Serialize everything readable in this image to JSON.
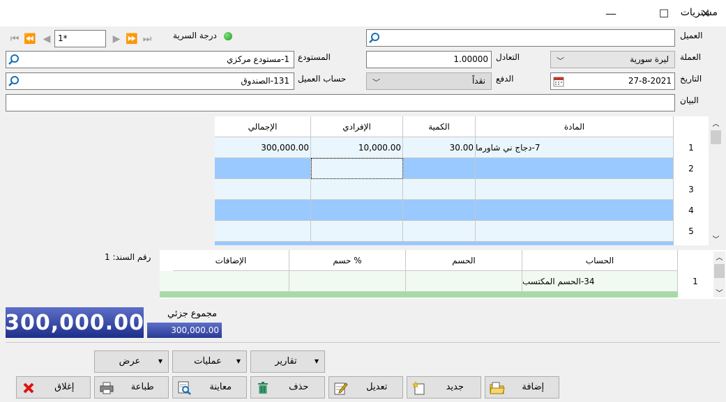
{
  "window": {
    "title": "مشتريات",
    "minimize": "—",
    "maximize": "☐",
    "close": "✕"
  },
  "nav": {
    "first": "⏮",
    "prev_fast": "⏪",
    "prev": "◀",
    "record": "1*",
    "next": "▶",
    "next_fast": "⏩",
    "last": "⏭"
  },
  "secrecy_label": "درجة السرية",
  "labels": {
    "customer": "العميل",
    "currency": "العملة",
    "date": "التاريخ",
    "description": "البيان",
    "exchange": "التعادل",
    "payment": "الدفع",
    "warehouse": "المستودع",
    "customer_account": "حساب العميل"
  },
  "values": {
    "customer": "",
    "currency": "ليرة سورية",
    "date": "27-8-2021",
    "description": "",
    "exchange": "1.00000",
    "payment": "نقداً",
    "warehouse": "1-مستودع مركزي",
    "customer_account": "131-الصندوق"
  },
  "items_table": {
    "columns": [
      "المادة",
      "الكمية",
      "الإفرادي",
      "الإجمالي"
    ],
    "rows": [
      {
        "num": "1",
        "item": "7-دجاج ني شاورما",
        "qty": "30.00",
        "unit": "10,000.00",
        "total": "300,000.00"
      },
      {
        "num": "2",
        "item": "",
        "qty": "",
        "unit": "",
        "total": ""
      },
      {
        "num": "3",
        "item": "",
        "qty": "",
        "unit": "",
        "total": ""
      },
      {
        "num": "4",
        "item": "",
        "qty": "",
        "unit": "",
        "total": ""
      },
      {
        "num": "5",
        "item": "",
        "qty": "",
        "unit": "",
        "total": ""
      }
    ]
  },
  "voucher_label": "رقم السند: 1",
  "discount_table": {
    "columns": [
      "الحساب",
      "الحسم",
      "حسم %",
      "الإضافات"
    ],
    "rows": [
      {
        "num": "1",
        "account": "34-الحسم المكتسب",
        "discount": "",
        "percent": "",
        "additions": ""
      }
    ]
  },
  "totals": {
    "grand": "300,000.00",
    "subtotal_label": "مجموع جزئي",
    "subtotal": "300,000.00"
  },
  "buttons": {
    "view": "عرض",
    "operations": "عمليات",
    "reports": "تقارير",
    "close": "إغلاق",
    "print": "طباعة",
    "preview": "معاينة",
    "delete": "حذف",
    "edit": "تعديل",
    "new": "جديد",
    "add": "إضافة"
  }
}
